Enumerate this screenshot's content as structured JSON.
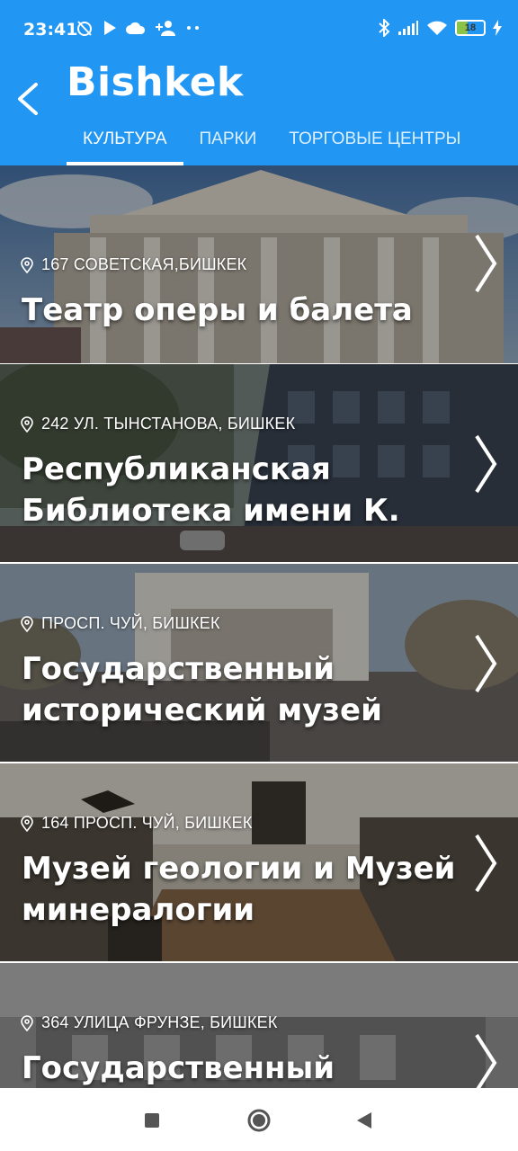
{
  "status_bar": {
    "time": "23:41",
    "battery": "18"
  },
  "header": {
    "title": "Bishkek",
    "back_icon": "chevron-left-icon",
    "tabs": [
      {
        "label": "КУЛЬТУРА",
        "active": true
      },
      {
        "label": "ПАРКИ",
        "active": false
      },
      {
        "label": "ТОРГОВЫЕ ЦЕНТРЫ",
        "active": false
      }
    ]
  },
  "colors": {
    "accent": "#2196F3",
    "tab_indicator": "#ffffff"
  },
  "places": [
    {
      "address": "167 СОВЕТСКАЯ,БИШКЕК",
      "name": "Театр оперы и балета"
    },
    {
      "address": "242 УЛ. ТЫНСТАНОВА, БИШКЕК",
      "name": "Республиканская Библиотека имени К."
    },
    {
      "address": "ПРОСП. ЧУЙ, БИШКЕК",
      "name": "Государственный исторический музей"
    },
    {
      "address": "164 ПРОСП. ЧУЙ, БИШКЕК",
      "name": "Музей геологии и Музей минералогии"
    },
    {
      "address": "364 УЛИЦА ФРУНЗЕ, БИШКЕК",
      "name": "Государственный"
    }
  ],
  "nav_bar": {
    "recents_icon": "square-icon",
    "home_icon": "circle-icon",
    "back_icon": "triangle-back-icon"
  }
}
